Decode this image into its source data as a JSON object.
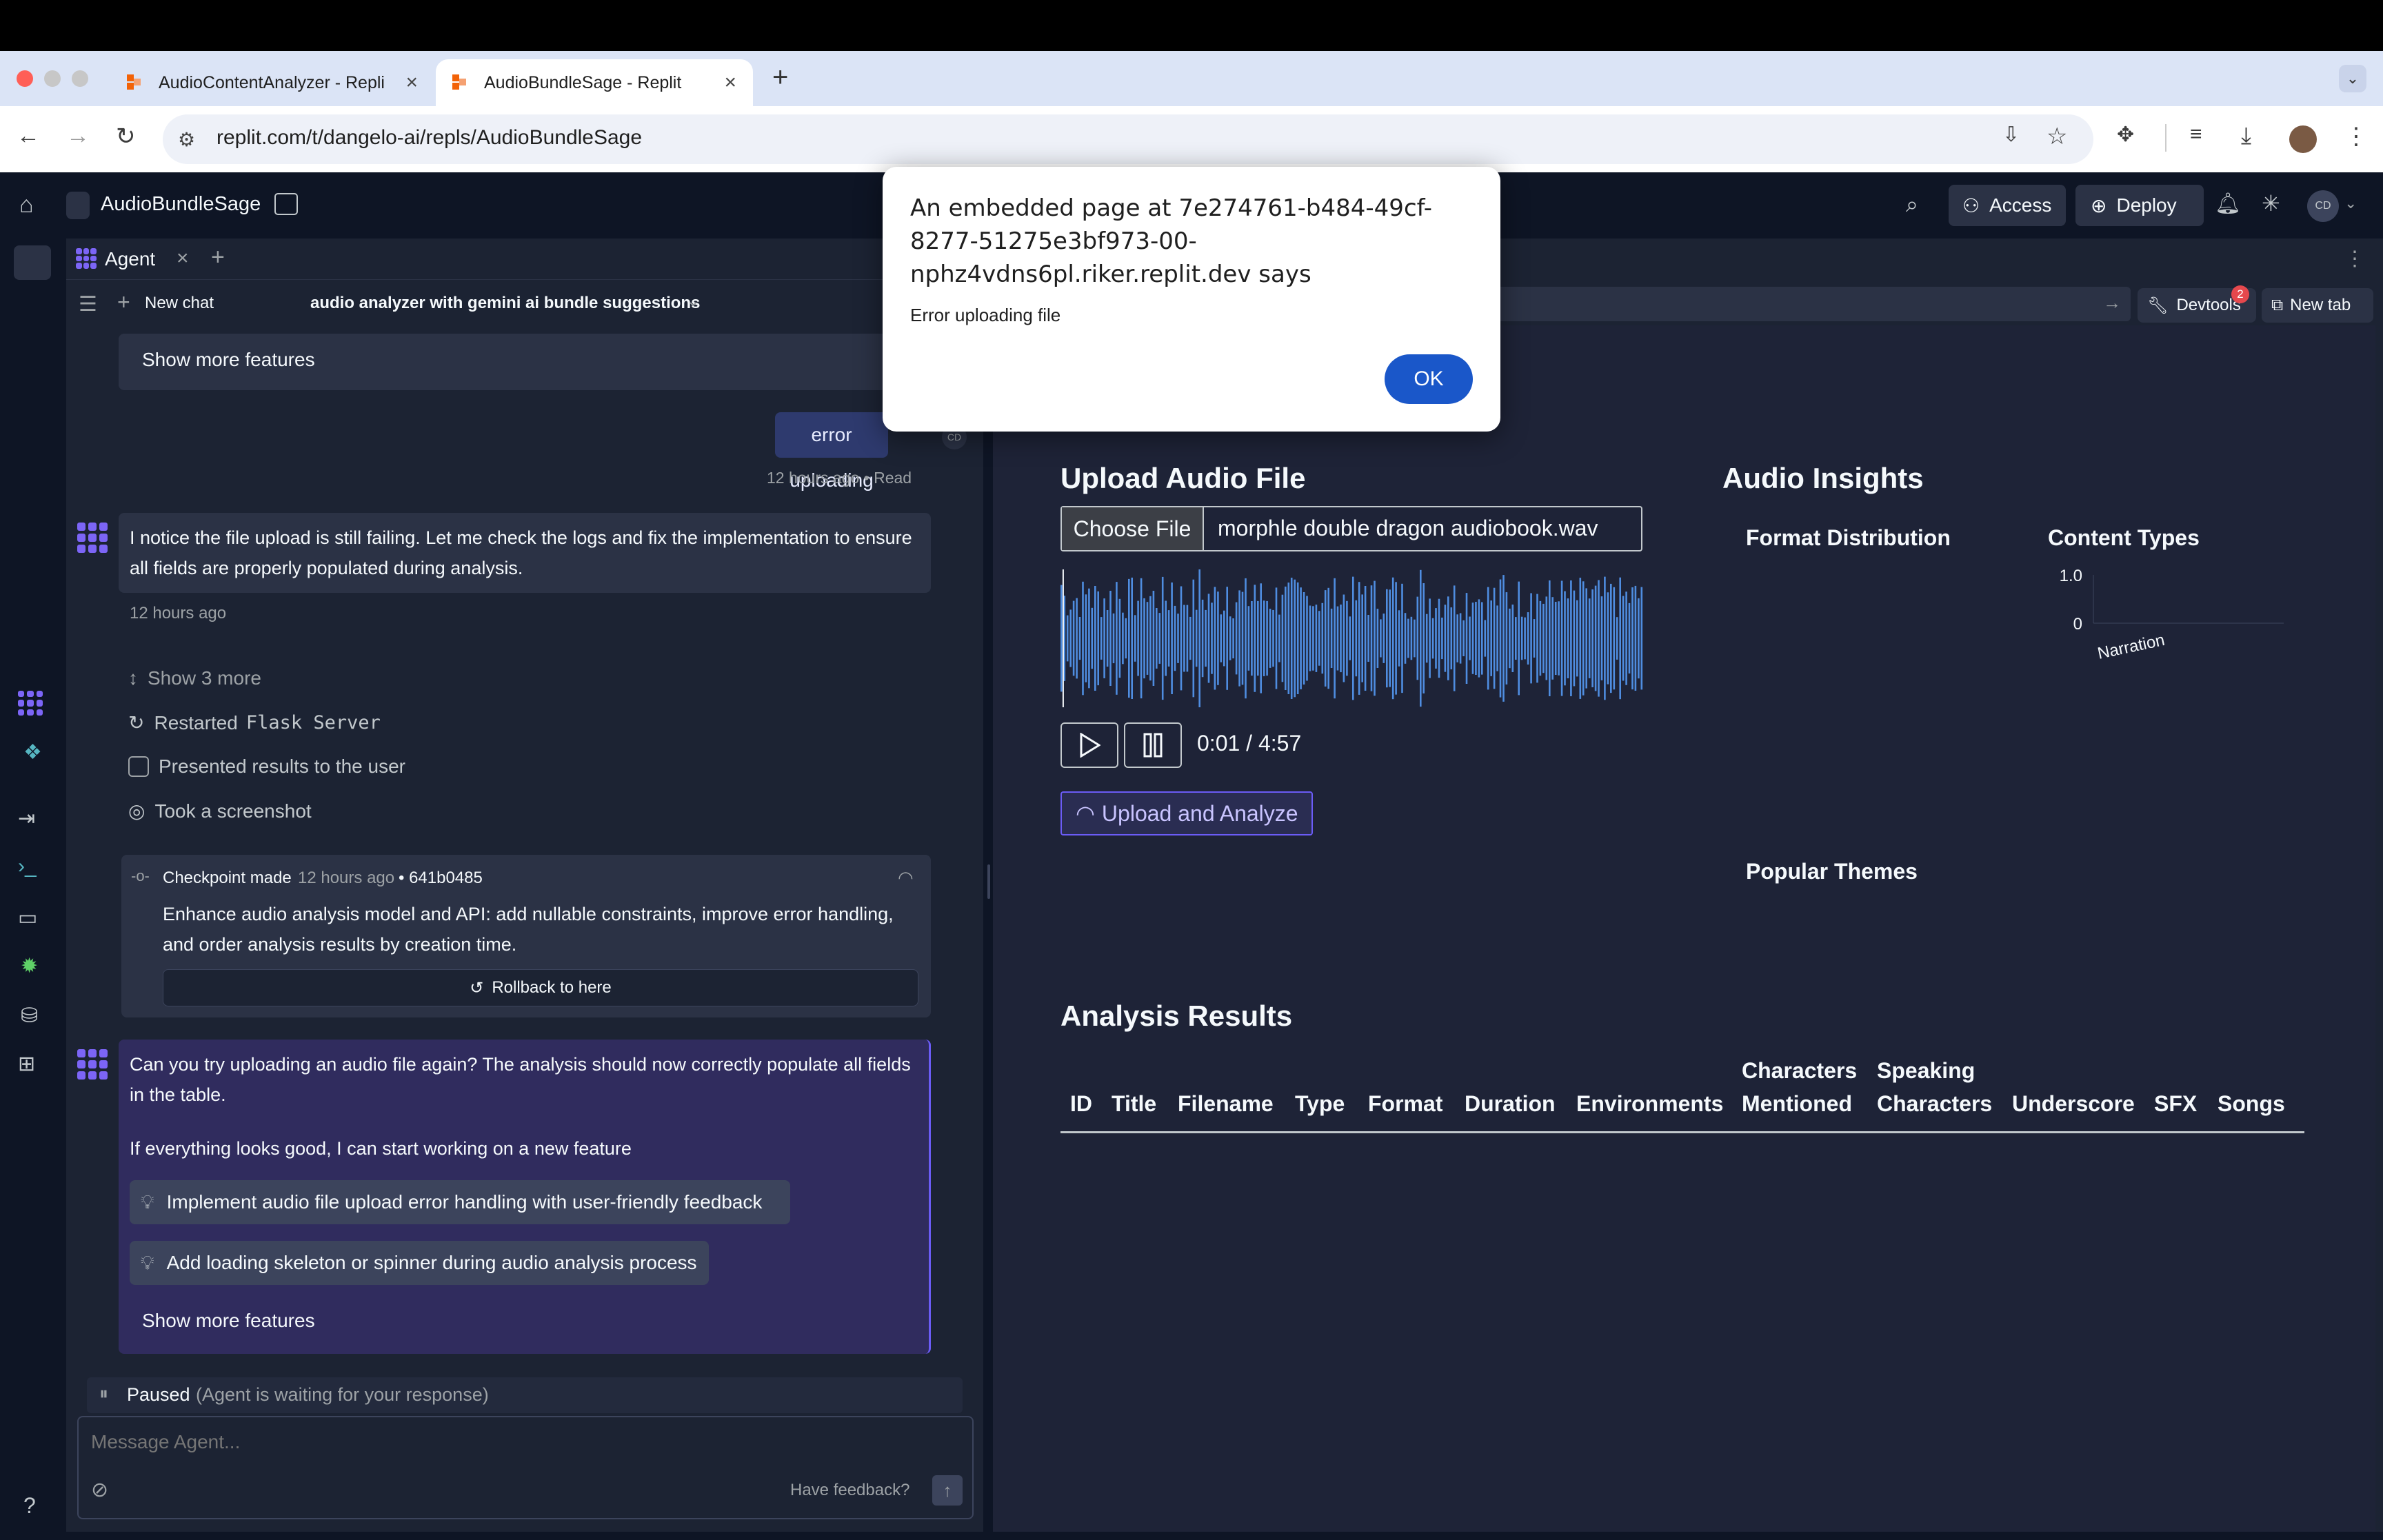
{
  "browser": {
    "tabs": [
      {
        "title": "AudioContentAnalyzer - Repli",
        "active": false
      },
      {
        "title": "AudioBundleSage - Replit",
        "active": true
      }
    ],
    "url": "replit.com/t/dangelo-ai/repls/AudioBundleSage"
  },
  "app": {
    "repl_name": "AudioBundleSage",
    "access_label": "Access",
    "deploy_label": "Deploy",
    "avatar_initials": "CD"
  },
  "agent": {
    "tab_label": "Agent",
    "new_chat_label": "New chat",
    "chat_title": "audio analyzer with gemini ai bundle suggestions",
    "show_more_top": "Show more features",
    "user_message": "error uploading",
    "user_initials": "CD",
    "user_meta": "12 hours ago • Read",
    "agent_msg1": "I notice the file upload is still failing. Let me check the logs and fix the implementation to ensure all fields are properly populated during analysis.",
    "agent_msg1_time": "12 hours ago",
    "steps": {
      "show_more": "Show 3 more",
      "restarted": "Restarted",
      "restarted_code": "Flask Server",
      "presented": "Presented results to the user",
      "screenshot": "Took a screenshot"
    },
    "checkpoint": {
      "label": "Checkpoint made",
      "time": "12 hours ago",
      "hash": "• 641b0485",
      "desc": "Enhance audio analysis model and API: add nullable constraints, improve error handling, and order analysis results by creation time.",
      "rollback": "Rollback to here"
    },
    "agent_msg2": "Can you try uploading an audio file again? The analysis should now correctly populate all fields in the table.",
    "agent_msg2b": "If everything looks good, I can start working on a new feature",
    "suggestion1": "Implement audio file upload error handling with user-friendly feedback",
    "suggestion2": "Add loading skeleton or spinner during audio analysis process",
    "show_more_bottom": "Show more features",
    "paused_label": "Paused",
    "paused_note": "(Agent is waiting for your response)",
    "input_placeholder": "Message Agent...",
    "feedback": "Have feedback?"
  },
  "preview_toolbar": {
    "devtools": "Devtools",
    "devtools_badge": "2",
    "new_tab": "New tab"
  },
  "preview": {
    "upload_title": "Upload Audio File",
    "choose_file": "Choose File",
    "file_name": "morphle double dragon audiobook.wav",
    "time": "0:01 / 4:57",
    "playback_progress": 0.0034,
    "upload_button": "Upload and Analyze",
    "insights_title": "Audio Insights",
    "format_distribution": "Format Distribution",
    "content_types": "Content Types",
    "popular_themes": "Popular Themes",
    "results_title": "Analysis Results",
    "columns": [
      "ID",
      "Title",
      "Filename",
      "Type",
      "Format",
      "Duration",
      "Environments",
      "Characters Mentioned",
      "Speaking Characters",
      "Underscore",
      "SFX",
      "Songs"
    ]
  },
  "chart_data": {
    "type": "bar",
    "title": "Content Types",
    "categories": [
      "Narration"
    ],
    "values": [
      0
    ],
    "y_ticks": [
      "1.0",
      "0"
    ],
    "ylim": [
      0,
      1.0
    ],
    "grid": false,
    "legend": "none"
  },
  "alert": {
    "title": "An embedded page at 7e274761-b484-49cf-8277-51275e3bf973-00-nphz4vdns6pl.riker.replit.dev says",
    "message": "Error uploading file",
    "ok": "OK"
  }
}
